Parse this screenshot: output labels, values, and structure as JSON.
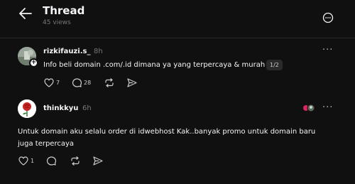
{
  "header": {
    "title": "Thread",
    "views": "45 views"
  },
  "posts": [
    {
      "username": "rizkifauzi.s_",
      "time": "8h",
      "text": "Info beli domain .com/.id dimana ya yang terpercaya & murah",
      "page_badge": "1/2",
      "likes": "7",
      "replies": "28",
      "reposts": "",
      "avatar_color": "#8a9487"
    },
    {
      "username": "thinkkyu",
      "time": "6h",
      "text": "Untuk domain aku selalu order di idwebhost Kak..banyak promo untuk domain baru juga terpercaya",
      "likes": "1",
      "replies": "",
      "reposts": "",
      "avatar_color": "#ffffff"
    }
  ],
  "colors": {
    "background": "#101010",
    "primary_text": "#f3f5f7",
    "secondary_text": "#777777",
    "reaction_red": "#e0245e"
  },
  "icons": {
    "back": "arrow-left-icon",
    "more": "more-circle-icon",
    "like": "heart-icon",
    "reply": "comment-icon",
    "repost": "repost-icon",
    "share": "send-icon",
    "add": "plus-icon"
  }
}
